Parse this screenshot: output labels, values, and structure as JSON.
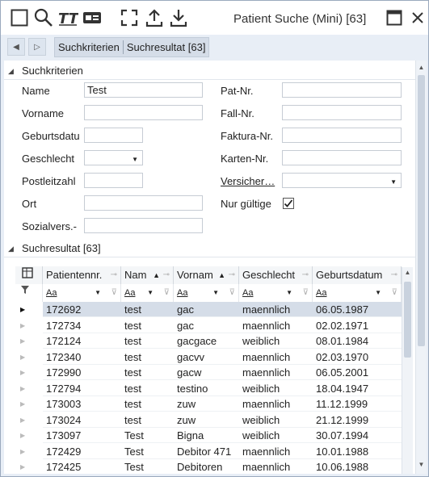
{
  "window": {
    "title": "Patient Suche (Mini) [63]"
  },
  "nav": {
    "breadcrumb": [
      "Suchkriterien",
      "Suchresultat [63]"
    ]
  },
  "search_section": {
    "title": "Suchkriterien",
    "fields_left": [
      {
        "label": "Name",
        "value": "Test"
      },
      {
        "label": "Vorname",
        "value": ""
      },
      {
        "label": "Geburtsdatu",
        "value": ""
      },
      {
        "label": "Geschlecht",
        "value": "",
        "type": "select"
      },
      {
        "label": "Postleitzahl",
        "value": ""
      },
      {
        "label": "Ort",
        "value": ""
      },
      {
        "label": "Sozialvers.-",
        "value": ""
      }
    ],
    "fields_right": [
      {
        "label": "Pat-Nr.",
        "value": ""
      },
      {
        "label": "Fall-Nr.",
        "value": ""
      },
      {
        "label": "Faktura-Nr.",
        "value": ""
      },
      {
        "label": "Karten-Nr.",
        "value": ""
      },
      {
        "label": "Versicher…",
        "value": "",
        "type": "select"
      },
      {
        "label": "Nur gültige",
        "checked": true,
        "type": "checkbox"
      }
    ]
  },
  "results_section": {
    "title": "Suchresultat [63]",
    "columns": [
      "Patientennr.",
      "Nam",
      "Vornam",
      "Geschlecht",
      "Geburtsdatum"
    ],
    "filter_placeholder": "Aa",
    "rows": [
      [
        "172692",
        "test",
        "gac",
        "maennlich",
        "06.05.1987"
      ],
      [
        "172734",
        "test",
        "gac",
        "maennlich",
        "02.02.1971"
      ],
      [
        "172124",
        "test",
        "gacgace",
        "weiblich",
        "08.01.1984"
      ],
      [
        "172340",
        "test",
        "gacvv",
        "maennlich",
        "02.03.1970"
      ],
      [
        "172990",
        "test",
        "gacw",
        "maennlich",
        "06.05.2001"
      ],
      [
        "172794",
        "test",
        "testino",
        "weiblich",
        "18.04.1947"
      ],
      [
        "173003",
        "test",
        "zuw",
        "maennlich",
        "11.12.1999"
      ],
      [
        "173024",
        "test",
        "zuw",
        "weiblich",
        "21.12.1999"
      ],
      [
        "173097",
        "Test",
        "Bigna",
        "weiblich",
        "30.07.1994"
      ],
      [
        "172429",
        "Test",
        "Debitor 471",
        "maennlich",
        "10.01.1988"
      ],
      [
        "172425",
        "Test",
        "Debitoren",
        "maennlich",
        "10.06.1988"
      ]
    ]
  },
  "icons": [
    "square-icon",
    "search-icon",
    "text-style-icon",
    "card-icon",
    "fullscreen-icon",
    "upload-icon",
    "download-icon",
    "maximize-icon",
    "close-icon"
  ]
}
